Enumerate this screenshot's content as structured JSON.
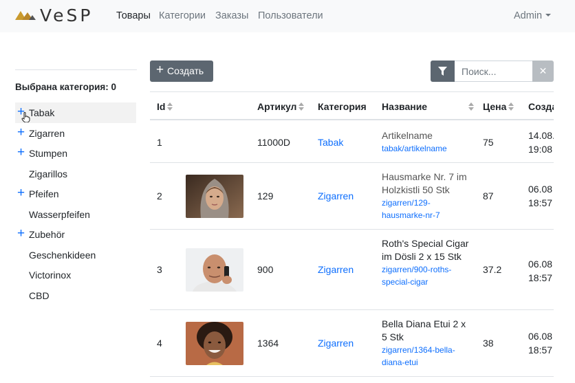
{
  "brand": {
    "word": "VeSP"
  },
  "nav": {
    "items": [
      {
        "label": "Товары",
        "active": true
      },
      {
        "label": "Категории",
        "active": false
      },
      {
        "label": "Заказы",
        "active": false
      },
      {
        "label": "Пользователи",
        "active": false
      }
    ],
    "user": "Admin"
  },
  "sidebar": {
    "title": "Выбрана категория: 0",
    "categories": [
      {
        "label": "Tabak",
        "expandable": true,
        "selected": true
      },
      {
        "label": "Zigarren",
        "expandable": true
      },
      {
        "label": "Stumpen",
        "expandable": true
      },
      {
        "label": "Zigarillos",
        "expandable": false
      },
      {
        "label": "Pfeifen",
        "expandable": true
      },
      {
        "label": "Wasserpfeifen",
        "expandable": false
      },
      {
        "label": "Zubehör",
        "expandable": true
      },
      {
        "label": "Geschenkideen",
        "expandable": false
      },
      {
        "label": "Victorinox",
        "expandable": false
      },
      {
        "label": "CBD",
        "expandable": false
      }
    ]
  },
  "toolbar": {
    "create_icon": "+",
    "create_label": "Создать",
    "search_placeholder": "Поиск...",
    "clear_label": "✕"
  },
  "table": {
    "headers": {
      "id": "Id",
      "sku": "Артикул",
      "category": "Категория",
      "name": "Название",
      "price": "Цена",
      "created": "Созда"
    },
    "rows": [
      {
        "id": "1",
        "sku": "11000D",
        "category": "Tabak",
        "name": "Artikelname",
        "slug": "tabak/artikelname",
        "price": "75",
        "created": [
          "14.08.",
          "19:08"
        ],
        "image": null
      },
      {
        "id": "2",
        "sku": "129",
        "category": "Zigarren",
        "name": "Hausmarke Nr. 7 im Holzkistli 50 Stk",
        "slug": "zigarren/129-hausmarke-nr-7",
        "price": "87",
        "created": [
          "06.08",
          "18:57"
        ],
        "image": "woman-hood-photo"
      },
      {
        "id": "3",
        "sku": "900",
        "category": "Zigarren",
        "name": "Roth's Special Cigar im Dösli 2 x 15 Stk",
        "slug": "zigarren/900-roths-special-cigar",
        "price": "37.2",
        "created": [
          "06.08",
          "18:57"
        ],
        "image": "man-phone-photo"
      },
      {
        "id": "4",
        "sku": "1364",
        "category": "Zigarren",
        "name": "Bella Diana Etui 2 x 5 Stk",
        "slug": "zigarren/1364-bella-diana-etui",
        "price": "38",
        "created": [
          "06.08",
          "18:57"
        ],
        "image": "woman-smile-photo"
      }
    ]
  },
  "colors": {
    "navbar_bg": "#f8f9fa",
    "link": "#0d6efd",
    "button_dark": "#5c6670",
    "logo_gold": "#c99a2e"
  }
}
